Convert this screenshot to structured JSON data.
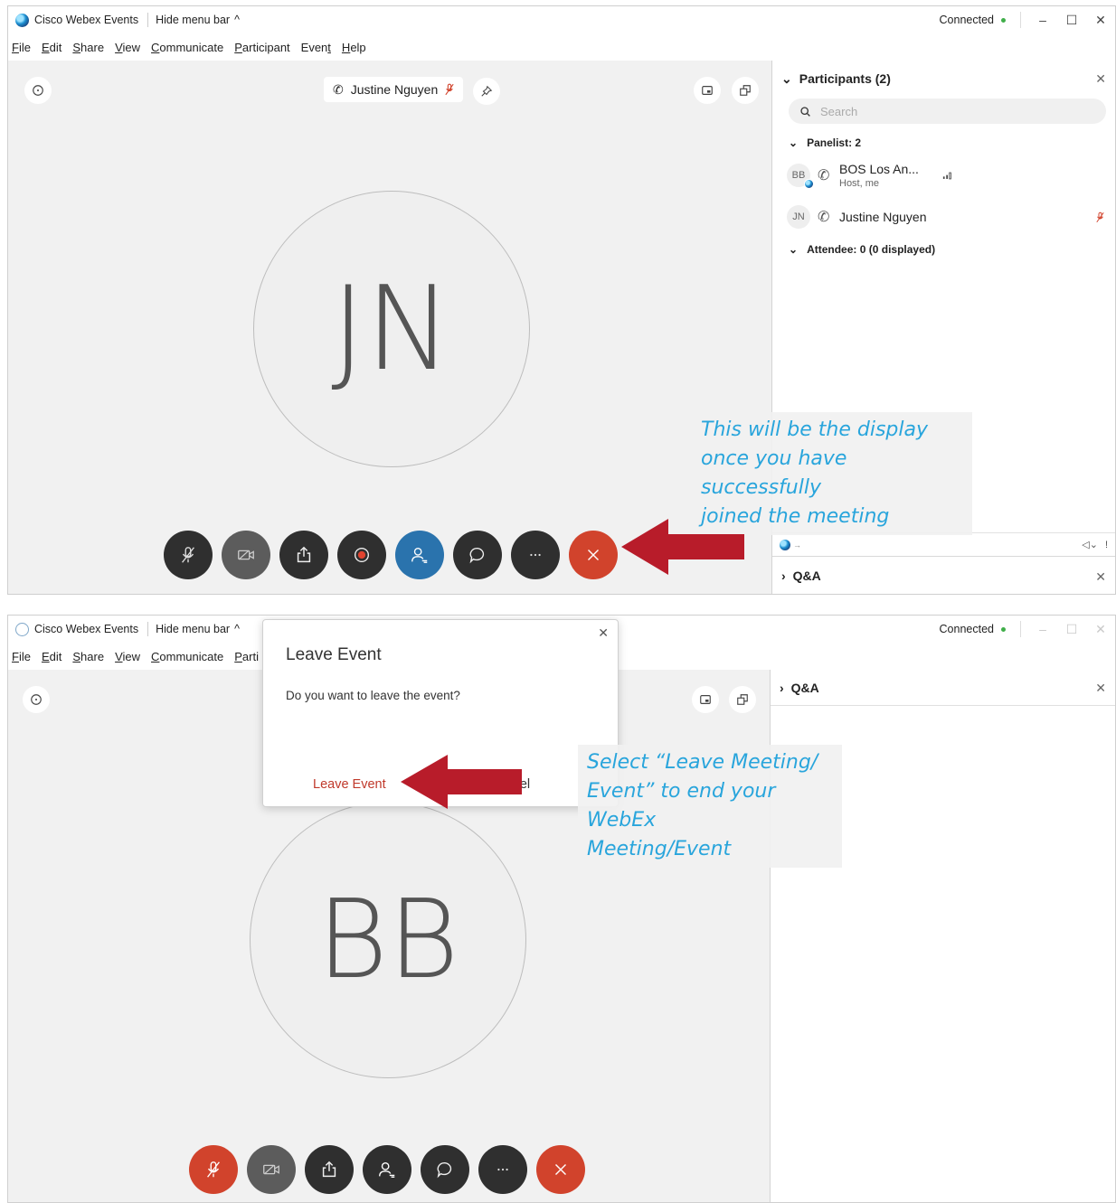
{
  "app": {
    "title": "Cisco Webex Events",
    "hide_menu": "Hide menu bar",
    "connected": "Connected",
    "menu": [
      "File",
      "Edit",
      "Share",
      "View",
      "Communicate",
      "Participant",
      "Event",
      "Help"
    ],
    "menu_underline": [
      "F",
      "E",
      "S",
      "V",
      "C",
      "P",
      "t",
      "H"
    ]
  },
  "screen1": {
    "active_speaker": "Justine Nguyen",
    "avatar_initials": "JN",
    "participants_panel": {
      "title": "Participants (2)",
      "search_placeholder": "Search",
      "panelist_group": "Panelist: 2",
      "participants": [
        {
          "initials": "BB",
          "name": "BOS Los An...",
          "role": "Host, me"
        },
        {
          "initials": "JN",
          "name": "Justine Nguyen",
          "role": ""
        }
      ],
      "attendee_group": "Attendee: 0 (0 displayed)"
    },
    "qa_label": "Q&A",
    "annotation": [
      "This will be the display",
      "once you have successfully",
      "joined the meeting"
    ]
  },
  "screen2": {
    "avatar_initials": "BB",
    "qa_label": "Q&A",
    "dialog": {
      "title": "Leave Event",
      "message": "Do you want to leave the event?",
      "leave_button": "Leave Event",
      "cancel_button": "Cancel",
      "cancel_visible_fragment": "ncel"
    },
    "menu_truncated": "Parti",
    "annotation": [
      "Select “Leave Meeting/",
      "Event” to end your WebEx",
      "Meeting/Event"
    ]
  },
  "colors": {
    "accent_blue": "#2a73ad",
    "end_red": "#d1432c",
    "annotation_blue": "#29a5dc",
    "arrow_red": "#b81c2a",
    "connected_green": "#3fae49"
  }
}
